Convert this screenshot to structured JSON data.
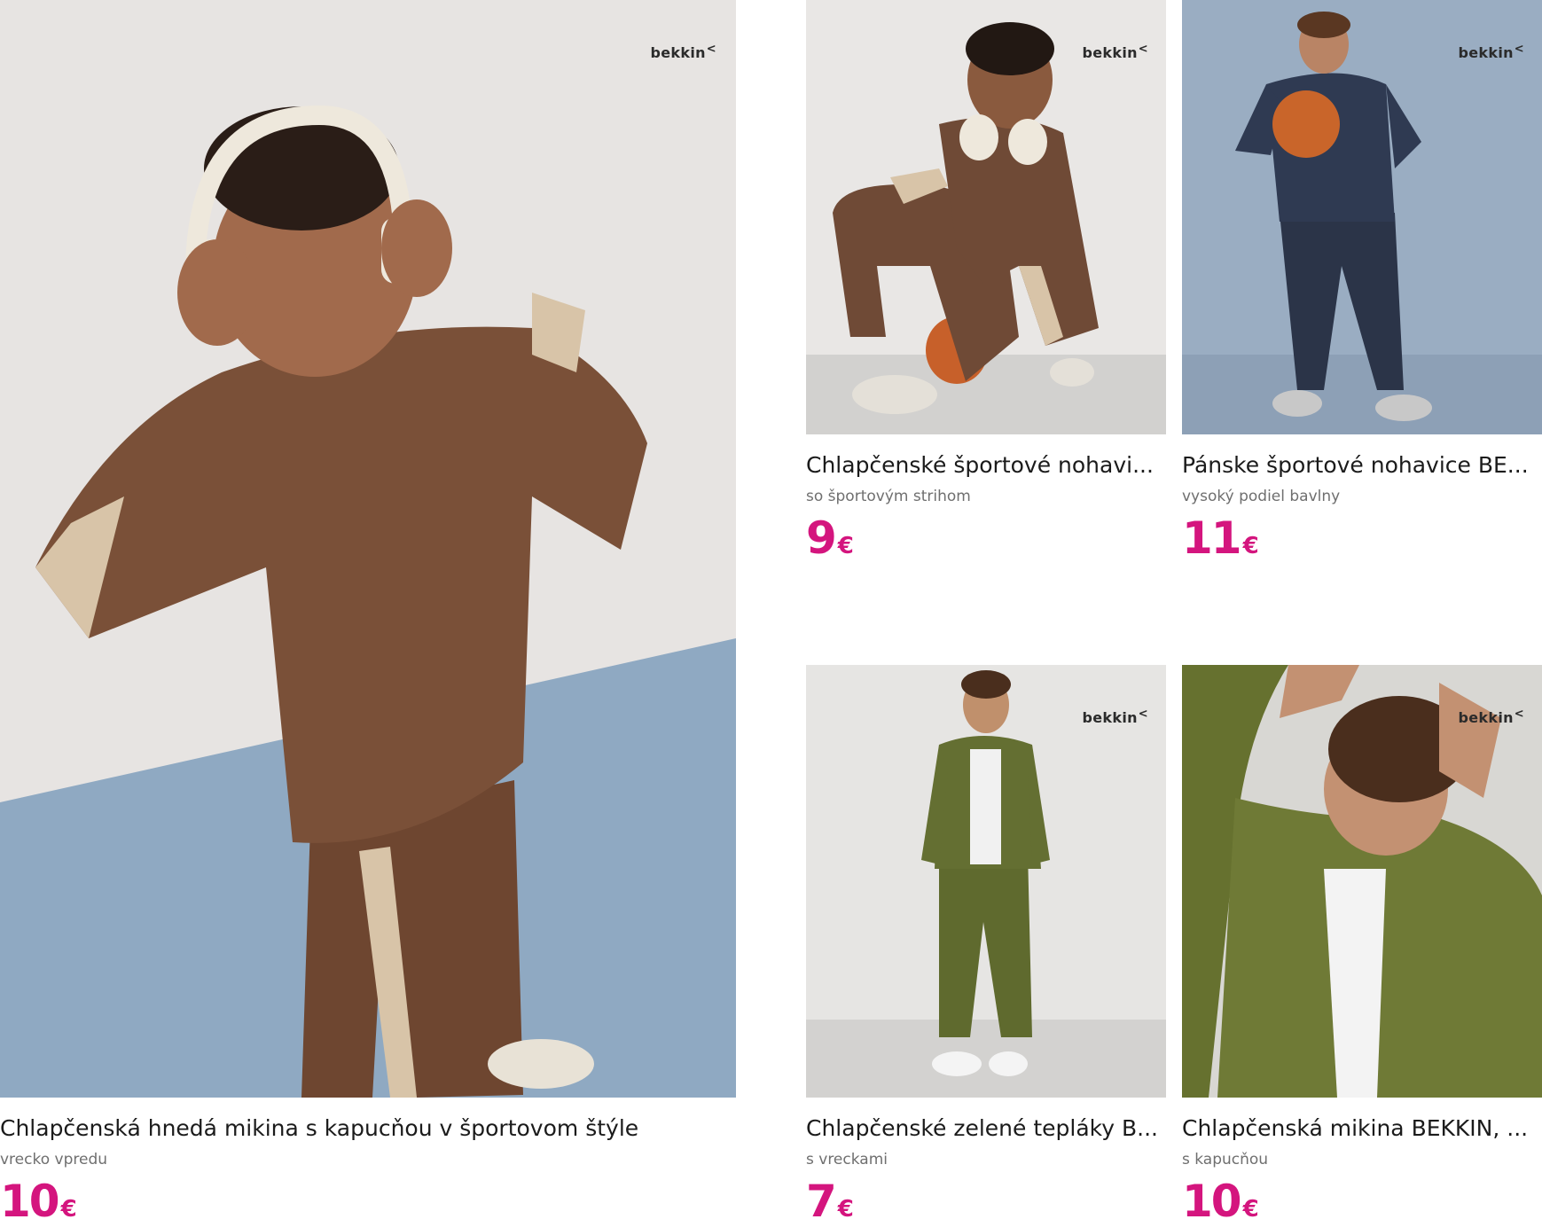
{
  "products": [
    {
      "brand": "bekkin",
      "title": "Chlapčenská hnedá mikina s kapucňou v športovom štýle",
      "subtitle": "vrecko vpredu",
      "price": "10",
      "currency": "€"
    },
    {
      "brand": "bekkin",
      "title": "Chlapčenské športové nohavi...",
      "subtitle": "so športovým strihom",
      "price": "9",
      "currency": "€"
    },
    {
      "brand": "bekkin",
      "title": "Pánske športové nohavice BE...",
      "subtitle": "vysoký podiel bavlny",
      "price": "11",
      "currency": "€"
    },
    {
      "brand": "bekkin",
      "title": "Chlapčenské zelené tepláky B...",
      "subtitle": "s vreckami",
      "price": "7",
      "currency": "€"
    },
    {
      "brand": "bekkin",
      "title": "Chlapčenská mikina BEKKIN, ...",
      "subtitle": "s kapucňou",
      "price": "10",
      "currency": "€"
    }
  ],
  "colors": {
    "price": "#d4157e",
    "title": "#1b1b1b",
    "subtitle": "#6f6f6f"
  }
}
